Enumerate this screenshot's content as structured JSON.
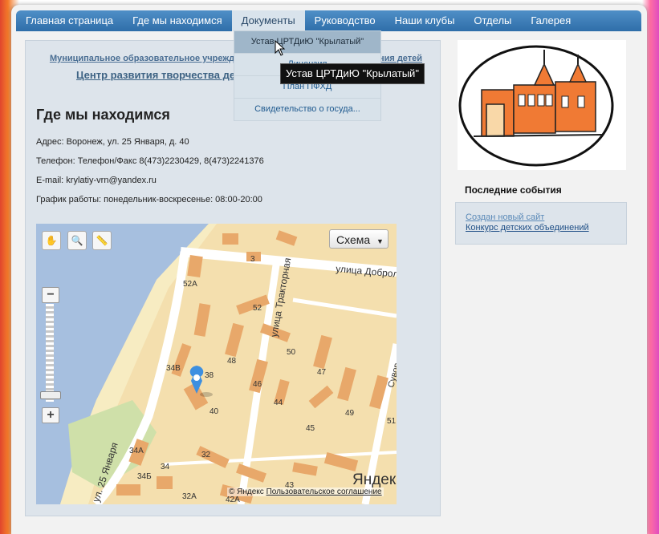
{
  "nav": {
    "items": [
      {
        "label": "Главная страница",
        "active": false
      },
      {
        "label": "Где мы находимся",
        "active": false
      },
      {
        "label": "Документы",
        "active": true
      },
      {
        "label": "Руководство",
        "active": false
      },
      {
        "label": "Наши клубы",
        "active": false
      },
      {
        "label": "Отделы",
        "active": false
      },
      {
        "label": "Галерея",
        "active": false
      }
    ]
  },
  "dropdown": {
    "items": [
      {
        "label": "Устав ЦРТДиЮ \"Крылатый\"",
        "hovered": true
      },
      {
        "label": "Лицензия",
        "hovered": false
      },
      {
        "label": "План ПФХД",
        "hovered": false
      },
      {
        "label": "Свидетельство о госуда...",
        "hovered": false
      }
    ],
    "tooltip": "Устав ЦРТДиЮ \"Крылатый\""
  },
  "main": {
    "org_name": "Муниципальное образовательное учреждение дополнительного образования детей",
    "center_name": "Центр развития творчества детей и юношества «Крылатый»",
    "title": "Где мы находимся",
    "address": "Адрес: Воронеж, ул. 25 Января, д. 40",
    "phone": "Телефон: Телефон/Факс 8(473)2230429, 8(473)2241376",
    "email": "E-mail: krylatiy-vrn@yandex.ru",
    "schedule": "График работы: понедельник-воскресенье: 08:00-20:00"
  },
  "map": {
    "scheme_label": "Схема",
    "copyright": "© Яндекс",
    "agreement": "Пользовательское соглашение",
    "logo": "Яндекс",
    "street_dobrolyubova": "улица Доброль",
    "street_traktornaya": "улица Тракторная",
    "street_25_yanvarya": "ул. 25 Января",
    "street_suvorova": "Сувор",
    "house_numbers": [
      "3",
      "52А",
      "52",
      "50",
      "48",
      "47",
      "46",
      "44",
      "34В",
      "38",
      "40",
      "49",
      "45",
      "51",
      "34А",
      "34",
      "34Б",
      "32",
      "32А",
      "42А",
      "43"
    ],
    "colors": {
      "water": "#a6bfdf",
      "land": "#f4dfae",
      "building": "#e8a86a",
      "road": "#ffffff",
      "marker": "#3d8fe0"
    }
  },
  "sidebar": {
    "events_title": "Последние события",
    "events": [
      {
        "label": "Создан новый сайт",
        "color": "#5b8ab8"
      },
      {
        "label": "Конкурс детских объединений",
        "color": "#1f4f86"
      }
    ]
  }
}
